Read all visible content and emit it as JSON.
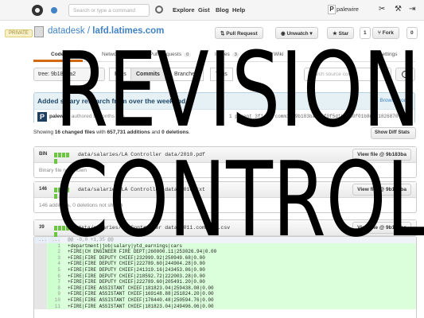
{
  "header": {
    "search_placeholder": "Search or type a command",
    "nav": [
      "Explore",
      "Gist",
      "Blog",
      "Help"
    ],
    "username": "palewire",
    "avatar_letter": "P",
    "icons": [
      "octocat-icon",
      "notification-icon",
      "settings-icon",
      "tools-icon",
      "logout-icon"
    ]
  },
  "repo": {
    "private_label": "PRIVATE",
    "owner": "datadesk",
    "separator": " / ",
    "name": "lafd.latimes.com",
    "pull_request": "Pull Request",
    "unwatch": "Unwatch",
    "star": "Star",
    "star_count": "1",
    "fork": "Fork",
    "fork_count": "0"
  },
  "tabs": {
    "code": "Code",
    "network": "Network",
    "pull_requests": "Pull Requests",
    "pull_requests_count": "0",
    "issues": "Issues",
    "issues_count": "3",
    "wiki": "Wiki",
    "graphs": "Graphs",
    "settings": "Settings"
  },
  "subnav": {
    "sha_label": "tree: 9b183ba2",
    "files": "Files",
    "commits": "Commits",
    "branches": "Branches",
    "tags": "Tags",
    "find_placeholder": "Search source code"
  },
  "commit": {
    "title": "Added salary research from over the weekend",
    "browse_code": "Browse code",
    "avatar_letter": "P",
    "author": "palewire",
    "authored_text": " authored 8 months ago",
    "parent_text": "1 parent 3f1cc3  commit 9b183ba2e5f0f5d1b99d0f01b8d381826870"
  },
  "stats": {
    "prefix": "Showing ",
    "changed_files": "16 changed files",
    "middle": " with ",
    "additions": "657,731 additions",
    "and": " and ",
    "deletions": "0 deletions",
    "split_button": "Show Diff Stats"
  },
  "files": [
    {
      "stat": "BIN",
      "path": "data/salaries/LA Controller data/2010.pdf",
      "view": "View file @ 9b183ba",
      "note": "Binary file not shown"
    },
    {
      "stat": "146",
      "path": "data/salaries/LA Controller data/2010.txt",
      "view": "View file @ 9b183ba",
      "note": "146 additions, 0 deletions not shown"
    },
    {
      "stat": "39",
      "path": "data/salaries/LA Controller data/2011.command.csv",
      "view": "View file @ 9b183ba",
      "note": ""
    }
  ],
  "diff": {
    "hunk": "@@ -0,0 +1,35 @@",
    "lines": [
      {
        "n": "1",
        "text": "+department|job|salary|ytd_earnings|cars"
      },
      {
        "n": "2",
        "text": "+FIRE|CH ENGINEER FIRE DEPT|260000.11|253026.94|0.00"
      },
      {
        "n": "3",
        "text": "+FIRE|FIRE DEPUTY CHIEF|232999.92|250949.68|0.00"
      },
      {
        "n": "4",
        "text": "+FIRE|FIRE DEPUTY CHIEF|222789.60|244904.28|0.00"
      },
      {
        "n": "5",
        "text": "+FIRE|FIRE DEPUTY CHIEF|241319.16|243453.86|0.00"
      },
      {
        "n": "6",
        "text": "+FIRE|FIRE DEPUTY CHIEF|218592.72|222003.28|0.00"
      },
      {
        "n": "7",
        "text": "+FIRE|FIRE DEPUTY CHIEF|222789.60|205491.20|0.00"
      },
      {
        "n": "8",
        "text": "+FIRE|FIRE ASSISTANT CHIEF|181823.04|259438.08|0.00"
      },
      {
        "n": "9",
        "text": "+FIRE|FIRE ASSISTANT CHIEF|169148.88|251824.20|0.00"
      },
      {
        "n": "10",
        "text": "+FIRE|FIRE ASSISTANT CHIEF|178440.48|250594.76|0.00"
      },
      {
        "n": "11",
        "text": "+FIRE|FIRE ASSISTANT CHIEF|181823.04|249496.06|0.00"
      }
    ]
  },
  "overlay": {
    "line1": "REVISION",
    "line2": "CONTROL"
  }
}
